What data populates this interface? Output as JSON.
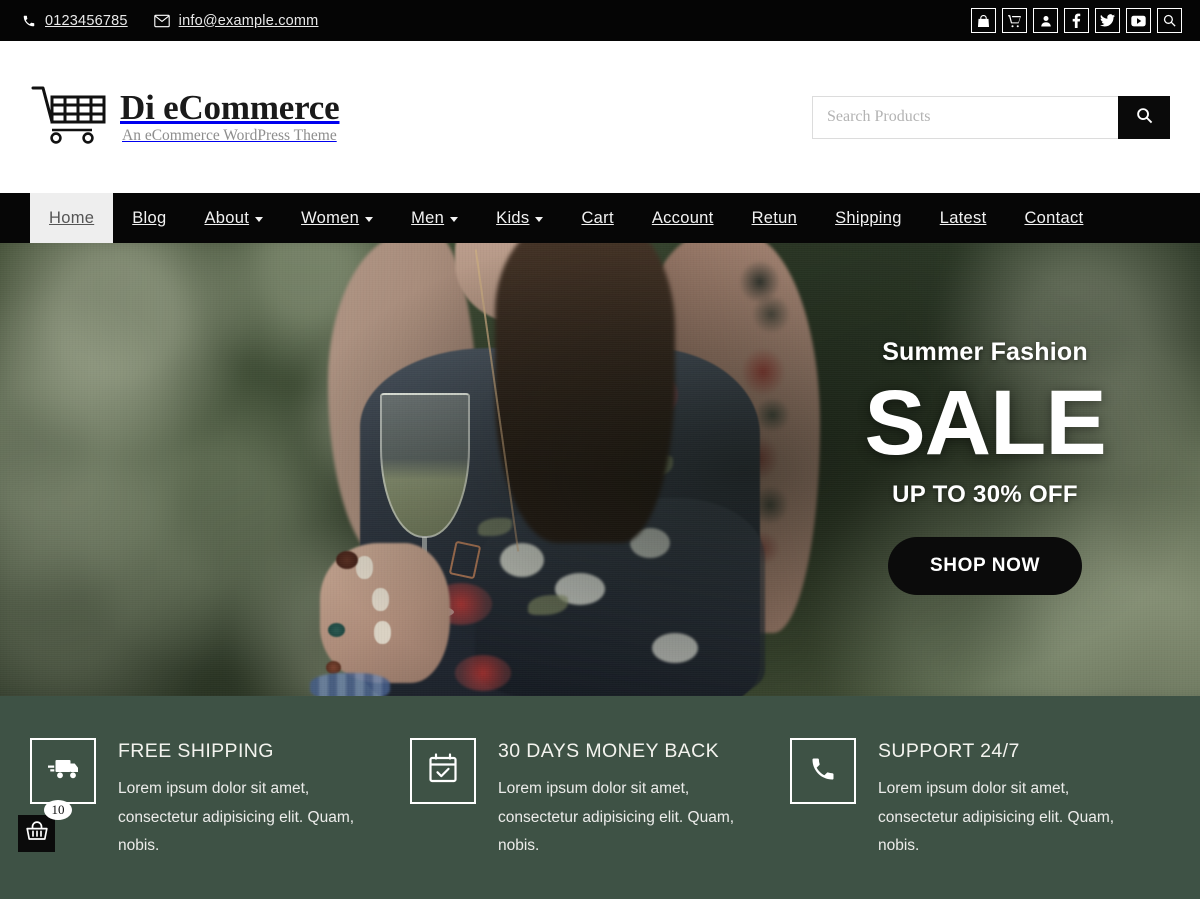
{
  "topbar": {
    "phone": "0123456785",
    "email": "info@example.comm",
    "icons": [
      {
        "name": "shopping-bag-icon",
        "label": "Shopping Bag"
      },
      {
        "name": "shopping-cart-icon",
        "label": "Cart"
      },
      {
        "name": "user-account-icon",
        "label": "Account"
      },
      {
        "name": "facebook-icon",
        "label": "Facebook"
      },
      {
        "name": "twitter-icon",
        "label": "Twitter"
      },
      {
        "name": "youtube-icon",
        "label": "YouTube"
      },
      {
        "name": "search-icon",
        "label": "Search"
      }
    ]
  },
  "brand": {
    "title": "Di eCommerce",
    "tagline": "An eCommerce WordPress Theme"
  },
  "search": {
    "placeholder": "Search Products",
    "value": "",
    "button_icon": "search-icon"
  },
  "nav": {
    "items": [
      {
        "label": "Home",
        "active": true,
        "caret": false
      },
      {
        "label": "Blog",
        "active": false,
        "caret": false
      },
      {
        "label": "About",
        "active": false,
        "caret": true
      },
      {
        "label": "Women",
        "active": false,
        "caret": true
      },
      {
        "label": "Men",
        "active": false,
        "caret": true
      },
      {
        "label": "Kids",
        "active": false,
        "caret": true
      },
      {
        "label": "Cart",
        "active": false,
        "caret": false
      },
      {
        "label": "Account",
        "active": false,
        "caret": false
      },
      {
        "label": "Retun",
        "active": false,
        "caret": false
      },
      {
        "label": "Shipping",
        "active": false,
        "caret": false
      },
      {
        "label": "Latest",
        "active": false,
        "caret": false
      },
      {
        "label": "Contact",
        "active": false,
        "caret": false
      }
    ]
  },
  "hero": {
    "subtitle": "Summer Fashion",
    "title": "SALE",
    "offer": "UP TO 30% OFF",
    "cta": "SHOP NOW"
  },
  "features": [
    {
      "icon": "delivery-truck-icon",
      "title": "FREE SHIPPING",
      "desc": "Lorem ipsum dolor sit amet, consectetur adipisicing elit. Quam, nobis."
    },
    {
      "icon": "calendar-check-icon",
      "title": "30 DAYS MONEY BACK",
      "desc": "Lorem ipsum dolor sit amet, consectetur adipisicing elit. Quam, nobis."
    },
    {
      "icon": "phone-icon",
      "title": "SUPPORT 24/7",
      "desc": "Lorem ipsum dolor sit amet, consectetur adipisicing elit. Quam, nobis."
    }
  ],
  "floating_cart": {
    "icon": "shopping-basket-icon",
    "count": "10"
  },
  "colors": {
    "topbar_bg": "#050505",
    "nav_bg": "#060606",
    "nav_active_bg": "#eeeeee",
    "features_bg": "#3e5245",
    "button_bg": "#0b0b0b"
  }
}
